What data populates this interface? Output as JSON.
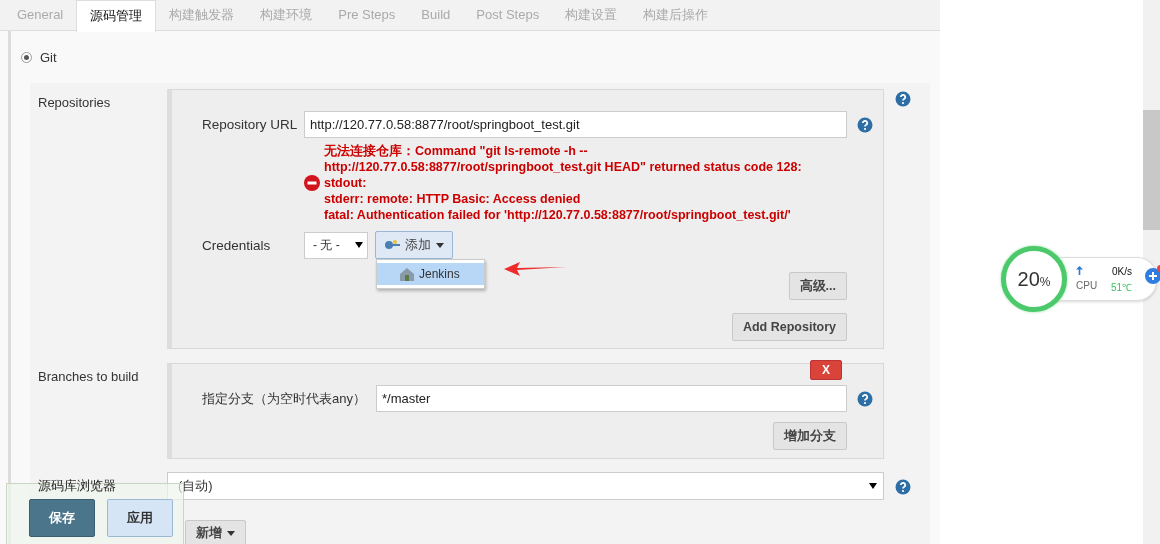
{
  "tabs": [
    {
      "label": "General",
      "selected": false
    },
    {
      "label": "源码管理",
      "selected": true
    },
    {
      "label": "构建触发器",
      "selected": false
    },
    {
      "label": "构建环境",
      "selected": false
    },
    {
      "label": "Pre Steps",
      "selected": false
    },
    {
      "label": "Build",
      "selected": false
    },
    {
      "label": "Post Steps",
      "selected": false
    },
    {
      "label": "构建设置",
      "selected": false
    },
    {
      "label": "构建后操作",
      "selected": false
    }
  ],
  "scm": {
    "label": "Git",
    "selected": true
  },
  "repositories": {
    "label": "Repositories",
    "url_label": "Repository URL",
    "url": "http://120.77.0.58:8877/root/springboot_test.git",
    "error_lines": [
      "无法连接仓库：Command \"git ls-remote -h --",
      "http://120.77.0.58:8877/root/springboot_test.git HEAD\" returned status code 128:",
      "stdout:",
      "stderr: remote: HTTP Basic: Access denied",
      "fatal: Authentication failed for 'http://120.77.0.58:8877/root/springboot_test.git/'"
    ],
    "credentials_label": "Credentials",
    "credentials_value": "- 无 -",
    "add_button": "添加",
    "add_menu": [
      {
        "label": "Jenkins",
        "selected": true
      }
    ],
    "advanced_button": "高级...",
    "add_repository_button": "Add Repository"
  },
  "branches": {
    "label": "Branches to build",
    "remove_button": "X",
    "spec_label": "指定分支（为空时代表any）",
    "spec_value": "*/master",
    "add_branch_button": "增加分支"
  },
  "browser": {
    "label": "源码库浏览器",
    "value": "(自动)"
  },
  "new_button": "新增",
  "actions": [
    {
      "label": "保存",
      "kind": "primary"
    },
    {
      "label": "应用",
      "kind": "secondary"
    }
  ],
  "monitor": {
    "percent": "20",
    "unit": "%",
    "upload_speed": "0K/s",
    "cpu_label": "CPU",
    "cpu_temp": "51℃"
  }
}
